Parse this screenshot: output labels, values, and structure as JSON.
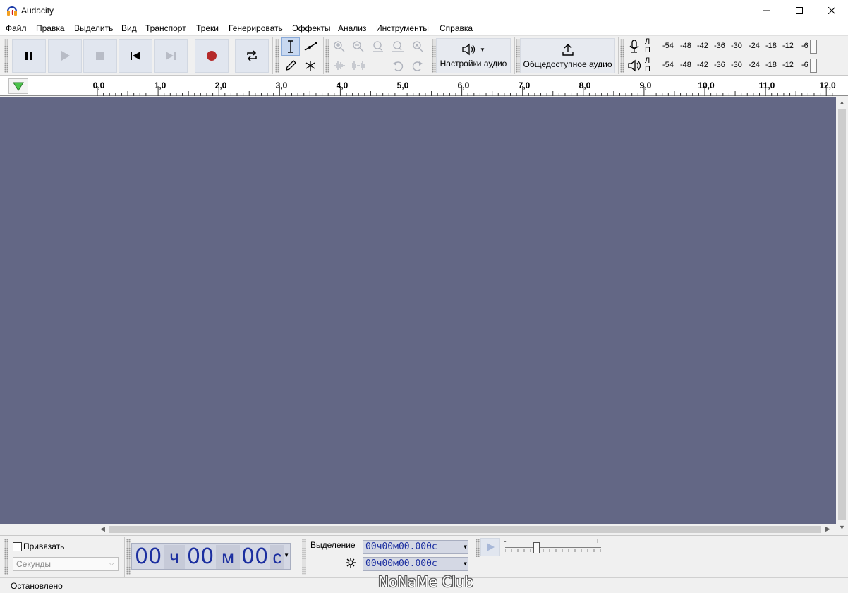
{
  "window": {
    "title": "Audacity"
  },
  "menu": [
    "Файл",
    "Правка",
    "Выделить",
    "Вид",
    "Транспорт",
    "Треки",
    "Генерировать",
    "Эффекты",
    "Анализ",
    "Инструменты",
    "Справка"
  ],
  "toolbar": {
    "audio_setup_label": "Настройки аудио",
    "share_audio_label": "Общедоступное аудио",
    "meter_channel_top": "Л",
    "meter_channel_bottom": "П",
    "meter_scale": [
      "-54",
      "-48",
      "-42",
      "-36",
      "-30",
      "-24",
      "-18",
      "-12",
      "-6"
    ]
  },
  "ruler": {
    "labels": [
      "0,0",
      "1,0",
      "2,0",
      "3,0",
      "4,0",
      "5,0",
      "6,0",
      "7,0",
      "8,0",
      "9,0",
      "10,0",
      "11,0",
      "12,0"
    ]
  },
  "colors": {
    "track_background": "#636785",
    "time_digits": "#1c2fa0",
    "record_button": "#b52a2a"
  },
  "snap": {
    "label": "Привязать",
    "checked": false,
    "units": "Секунды"
  },
  "time": {
    "hours": "00",
    "hours_unit": "ч",
    "minutes": "00",
    "minutes_unit": "м",
    "seconds": "00",
    "seconds_unit": "с"
  },
  "selection": {
    "label": "Выделение",
    "start": "00ч00м00.000с",
    "end": "00ч00м00.000с"
  },
  "play_speed": {
    "minus": "-",
    "plus": "+"
  },
  "status": {
    "text": "Остановлено"
  },
  "watermark": "NoNaMe Club"
}
